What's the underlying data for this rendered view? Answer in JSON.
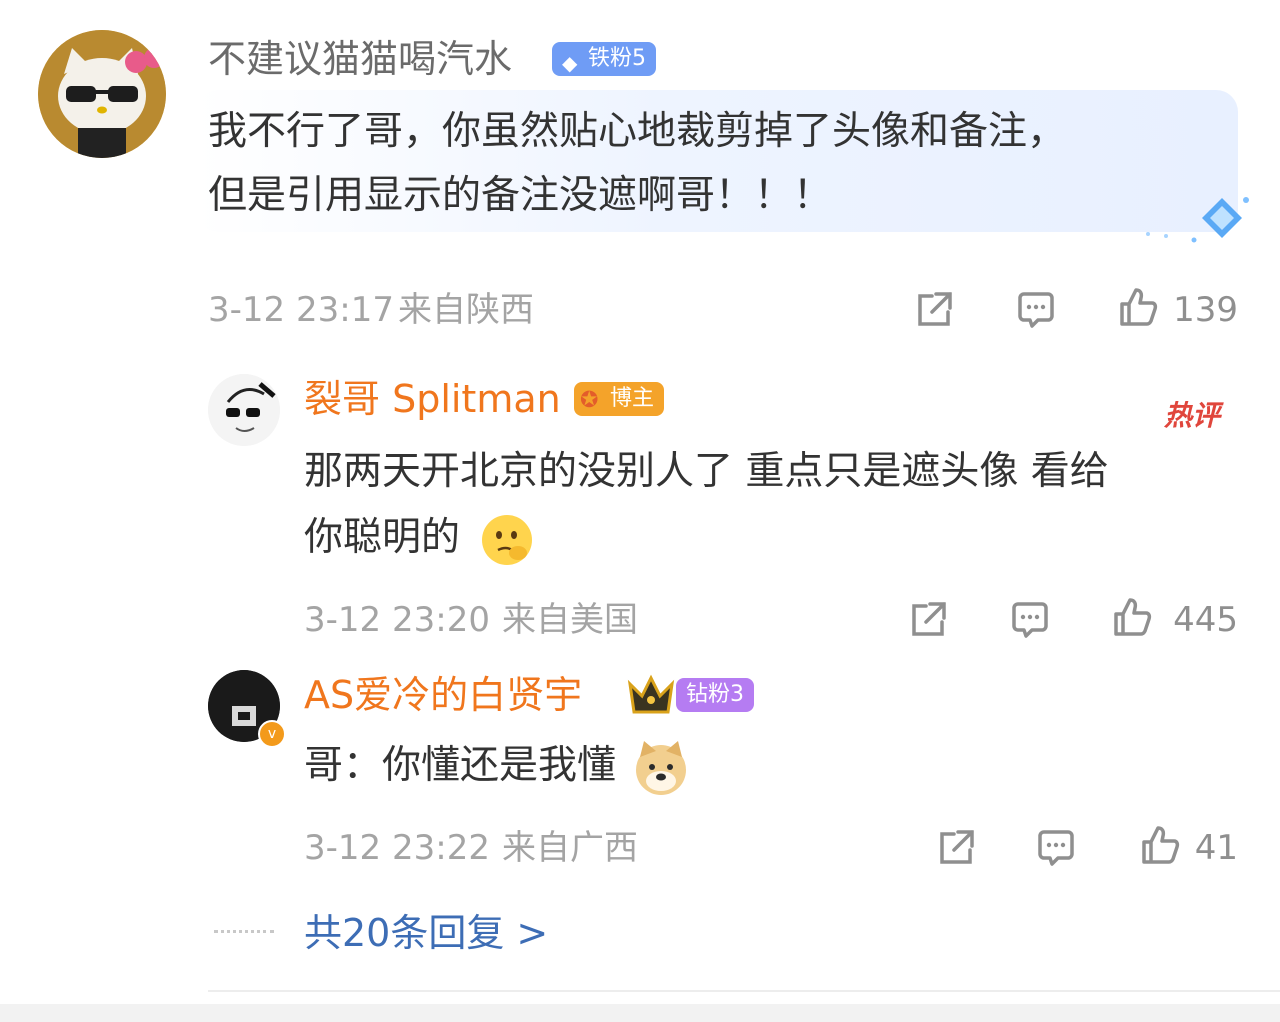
{
  "comments": [
    {
      "author": "不建议猫猫喝汽水",
      "badge": "铁粉5",
      "text_lines": [
        "我不行了哥，你虽然贴心地裁剪掉了头像和备注，",
        "但是引用显示的备注没遮啊哥！！！"
      ],
      "time": "3-12 23:17",
      "location": "来自陕西",
      "likes": "139"
    },
    {
      "author": "裂哥 Splitman",
      "badge": "博主",
      "hot_tag": "热评",
      "text_lines": [
        "那两天开北京的没别人了 重点只是遮头像 看给",
        "你聪明的"
      ],
      "time": "3-12 23:20",
      "location": "来自美国",
      "likes": "445"
    },
    {
      "author": "AS爱冷的白贤宇",
      "badge": "钻粉3",
      "text_lines": [
        "哥：你懂还是我懂"
      ],
      "time": "3-12 23:22",
      "location": "来自广西",
      "likes": "41"
    }
  ],
  "more_replies": "共20条回复 >",
  "colors": {
    "name_gray": "#6b6b6b",
    "name_orange": "#f0761d",
    "link_blue": "#3d6db5",
    "meta_gray": "#a4a4a4",
    "badge_blue": "#6f9cf5",
    "badge_orange": "#f4a32a",
    "badge_purple": "#b57cf2"
  }
}
